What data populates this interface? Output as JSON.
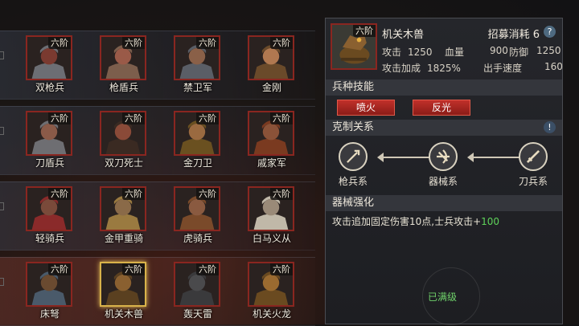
{
  "units": {
    "row1": [
      {
        "name": "双枪兵",
        "rank": "六阶",
        "skin": "#7a3a30",
        "armor": "#6c6e74"
      },
      {
        "name": "枪盾兵",
        "rank": "六阶",
        "skin": "#9a5a48",
        "armor": "#7c5e4c"
      },
      {
        "name": "禁卫军",
        "rank": "六阶",
        "skin": "#8a6048",
        "armor": "#5a5e66"
      },
      {
        "name": "金刚",
        "rank": "六阶",
        "skin": "#b07850",
        "armor": "#6a4a2a"
      }
    ],
    "row2": [
      {
        "name": "刀盾兵",
        "rank": "六阶",
        "skin": "#8a5a48",
        "armor": "#6e6e72"
      },
      {
        "name": "双刀死士",
        "rank": "六阶",
        "skin": "#8a4a38",
        "armor": "#3a2a22"
      },
      {
        "name": "金刀卫",
        "rank": "六阶",
        "skin": "#9a6a40",
        "armor": "#6a5020"
      },
      {
        "name": "戚家军",
        "rank": "六阶",
        "skin": "#8a5238",
        "armor": "#7a3a20"
      }
    ],
    "row3": [
      {
        "name": "轻骑兵",
        "rank": "六阶",
        "skin": "#7a4a3a",
        "armor": "#8a2a2a"
      },
      {
        "name": "金甲重骑",
        "rank": "六阶",
        "skin": "#8a6a48",
        "armor": "#9a7a40"
      },
      {
        "name": "虎骑兵",
        "rank": "六阶",
        "skin": "#8a5a40",
        "armor": "#7a4a2a"
      },
      {
        "name": "白马义从",
        "rank": "六阶",
        "skin": "#9a8a78",
        "armor": "#c0b8a8"
      }
    ],
    "row4": [
      {
        "name": "床弩",
        "rank": "六阶",
        "skin": "#6a4a30",
        "armor": "#4a5a6a"
      },
      {
        "name": "机关木兽",
        "rank": "六阶",
        "skin": "#8a6030",
        "armor": "#5a4020",
        "selected": true
      },
      {
        "name": "轰天雷",
        "rank": "六阶",
        "skin": "#4a4a4c",
        "armor": "#3a3a3c"
      },
      {
        "name": "机关火龙",
        "rank": "六阶",
        "skin": "#9a6a30",
        "armor": "#6a4a20"
      }
    ]
  },
  "detail": {
    "rank": "六阶",
    "title": "机关木兽",
    "cost_label": "招募消耗",
    "cost_value": "6",
    "help": "?",
    "stats": {
      "attack_label": "攻击",
      "attack_value": "1250",
      "hp_label": "血量",
      "hp_value": "900",
      "def_label": "防御",
      "def_value": "1250",
      "atkbonus_label": "攻击加成",
      "atkbonus_value": "1825%",
      "speed_label": "出手速度",
      "speed_value": "160"
    },
    "skills_title": "兵种技能",
    "skills": [
      "喷火",
      "反光"
    ],
    "counter_title": "克制关系",
    "counter_warn": "!",
    "counter": [
      {
        "label": "枪兵系",
        "icon": "spear-icon"
      },
      {
        "label": "器械系",
        "icon": "crossbow-icon"
      },
      {
        "label": "刀兵系",
        "icon": "sword-icon"
      }
    ],
    "enhance_title": "器械强化",
    "enhance_text": "攻击追加固定伤害10点,士兵攻击+",
    "enhance_bonus": "100",
    "max_label": "已满级"
  },
  "colors": {
    "rank_frame": "#8a2620",
    "selected_frame": "#d8b24a",
    "skill_red": "#c0302a",
    "bonus_green": "#5fd35a"
  }
}
